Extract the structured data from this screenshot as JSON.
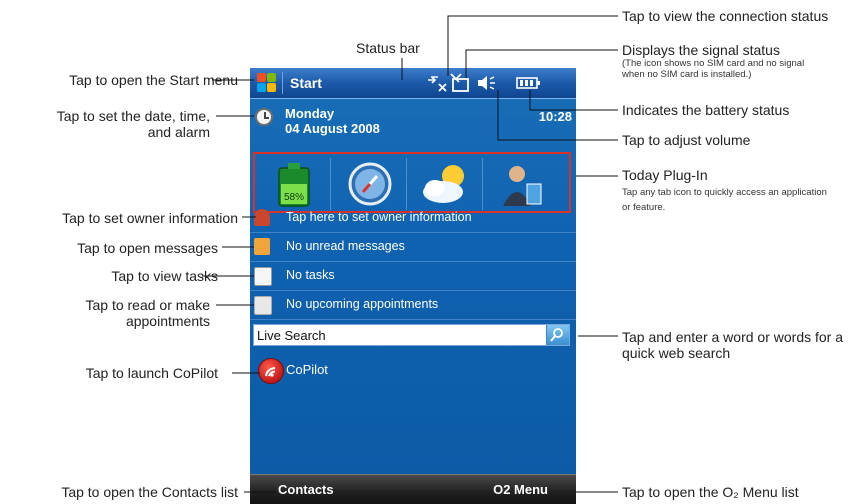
{
  "phone": {
    "start_label": "Start",
    "date_day": "Monday",
    "date_full": "04 August 2008",
    "time": "10:28",
    "battery_percent": "58%",
    "today_rows": [
      "Tap here to set owner information",
      "No unread messages",
      "No tasks",
      "No upcoming appointments"
    ],
    "search_text": "Live Search",
    "copilot_label": "CoPilot",
    "left_softkey": "Contacts",
    "right_softkey": "O2 Menu"
  },
  "annotations": {
    "start_menu": "Tap to open the Start menu",
    "date_time_1": "Tap to set the date, time,",
    "date_time_2": "and alarm",
    "owner_info": "Tap to set owner information",
    "messages": "Tap to open messages",
    "tasks": "Tap to view tasks",
    "appointments_1": "Tap to read or make",
    "appointments_2": "appointments",
    "copilot": "Tap to launch CoPilot",
    "contacts": "Tap to open the Contacts list",
    "status_bar": "Status bar",
    "connection_status": "Tap to view the connection status",
    "signal_status": "Displays the signal status",
    "signal_note_1": "(The icon shows no SIM card and no signal",
    "signal_note_2": "when no SIM card is installed.)",
    "battery_status": "Indicates the battery status",
    "volume": "Tap to adjust volume",
    "plugin_title": "Today Plug-In",
    "plugin_note_1": "Tap any tab icon to quickly access an application",
    "plugin_note_2": "or feature.",
    "search_1": "Tap and enter a word or words for a",
    "search_2": "quick web search",
    "o2_menu": "Tap to open the O₂ Menu list"
  },
  "colors": {
    "screen_blue": "#0f62b0",
    "highlight_red": "#d9312a",
    "leader_line": "#111111"
  }
}
